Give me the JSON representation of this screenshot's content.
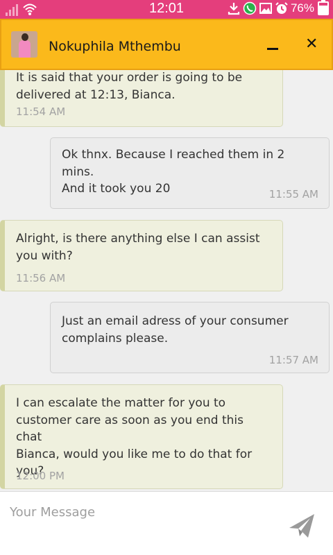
{
  "status_bar": {
    "time": "12:01",
    "battery": "76%",
    "battery_level": 0.76
  },
  "header": {
    "contact_name": "Nokuphila Mthembu",
    "minimize_symbol": "–",
    "close_symbol": "✕"
  },
  "messages": [
    {
      "direction": "incoming",
      "lines": [
        "It is said that your order is going to be",
        "delivered at 12:13, Bianca."
      ],
      "time": "11:54 AM"
    },
    {
      "direction": "outgoing",
      "lines": [
        "Ok thnx. Because I reached them in 2 mins.",
        "And it took you 20"
      ],
      "time": "11:55 AM"
    },
    {
      "direction": "incoming",
      "lines": [
        "Alright, is there anything else I can assist",
        "you with?"
      ],
      "time": "11:56 AM"
    },
    {
      "direction": "outgoing",
      "lines": [
        "Just an email adress of your consumer",
        "complains please."
      ],
      "time": "11:57 AM"
    },
    {
      "direction": "incoming",
      "lines": [
        "I can escalate the matter for you to",
        "customer care as soon as you end this chat",
        "Bianca, would you like me to do that for",
        "you?"
      ],
      "time": "12:00 PM"
    }
  ],
  "composer": {
    "placeholder": "Your Message",
    "value": ""
  },
  "icons": {
    "signal": "signal-icon",
    "wifi": "wifi-icon",
    "download": "download-icon",
    "whatsapp": "whatsapp-icon",
    "gallery": "image-icon",
    "alarm": "alarm-icon",
    "battery": "battery-icon",
    "send": "send-icon"
  },
  "colors": {
    "status_bar": "#e43e7c",
    "header": "#fbb91b",
    "incoming_bubble": "#eff0de",
    "outgoing_bubble": "#ececec"
  }
}
